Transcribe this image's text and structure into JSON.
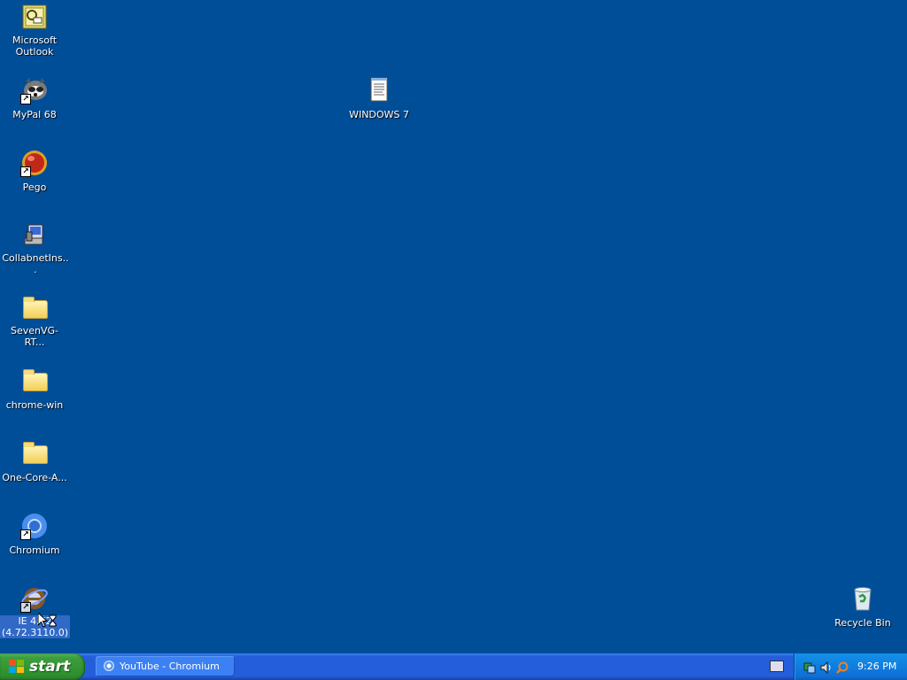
{
  "desktop": {
    "background_color": "#004e98",
    "icons": [
      {
        "label": "Microsoft Outlook",
        "icon": "outlook-icon"
      },
      {
        "label": "MyPal 68",
        "icon": "mypal-icon"
      },
      {
        "label": "Pego",
        "icon": "pego-icon"
      },
      {
        "label": "CollabnetIns...",
        "icon": "installer-icon"
      },
      {
        "label": "SevenVG-RT...",
        "icon": "folder-icon"
      },
      {
        "label": "chrome-win",
        "icon": "folder-icon"
      },
      {
        "label": "One-Core-A...",
        "icon": "folder-icon"
      },
      {
        "label": "Chromium",
        "icon": "chromium-icon"
      },
      {
        "label": "IE 4.72 (4.72.3110.0)",
        "icon": "internet-explorer-icon",
        "selected": true
      },
      {
        "label": "WINDOWS 7",
        "icon": "text-document-icon"
      },
      {
        "label": "Recycle Bin",
        "icon": "recycle-bin-icon"
      }
    ]
  },
  "taskbar": {
    "start_label": "start",
    "tasks": [
      {
        "label": "YouTube - Chromium",
        "icon": "chromium-icon"
      }
    ],
    "tray": {
      "icons": [
        "network-icon",
        "speaker-icon",
        "search-icon"
      ],
      "clock": "9:26 PM"
    }
  }
}
